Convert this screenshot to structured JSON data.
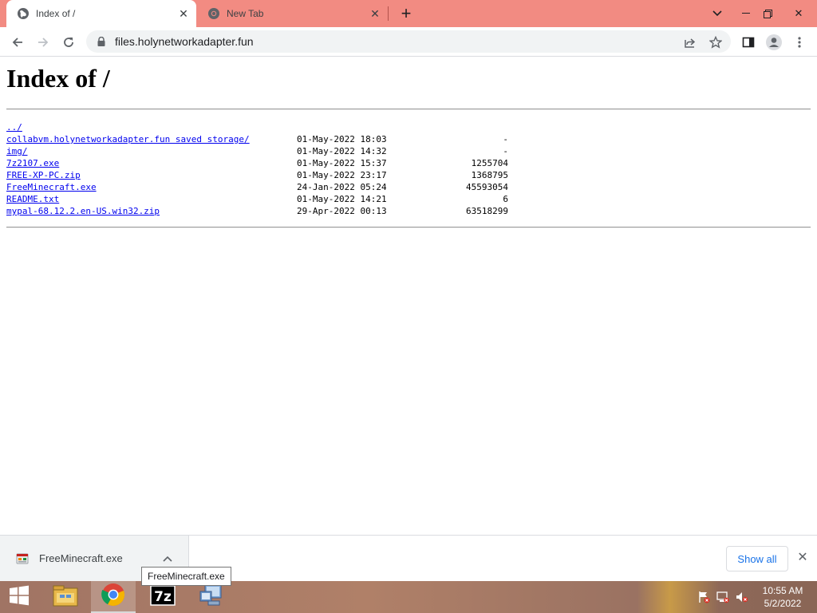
{
  "browser": {
    "tabs": [
      {
        "title": "Index of /",
        "active": true,
        "icon": "globe-icon"
      },
      {
        "title": "New Tab",
        "active": false,
        "icon": "chrome-icon"
      }
    ],
    "url": "files.holynetworkadapter.fun",
    "colors": {
      "tab_strip": "#f28b82",
      "link": "#0000ee",
      "accent": "#1a73e8"
    }
  },
  "page": {
    "title": "Index of /",
    "entries": [
      {
        "name": "../",
        "date": "",
        "size": ""
      },
      {
        "name": "collabvm.holynetworkadapter.fun saved storage/",
        "date": "01-May-2022 18:03",
        "size": "-"
      },
      {
        "name": "img/",
        "date": "01-May-2022 14:32",
        "size": "-"
      },
      {
        "name": "7z2107.exe",
        "date": "01-May-2022 15:37",
        "size": "1255704"
      },
      {
        "name": "FREE-XP-PC.zip",
        "date": "01-May-2022 23:17",
        "size": "1368795"
      },
      {
        "name": "FreeMinecraft.exe",
        "date": "24-Jan-2022 05:24",
        "size": "45593054"
      },
      {
        "name": "README.txt",
        "date": "01-May-2022 14:21",
        "size": "6"
      },
      {
        "name": "mypal-68.12.2.en-US.win32.zip",
        "date": "29-Apr-2022 00:13",
        "size": "63518299"
      }
    ]
  },
  "downloads": {
    "item_name": "FreeMinecraft.exe",
    "tooltip": "FreeMinecraft.exe",
    "show_all": "Show all"
  },
  "taskbar": {
    "apps": [
      "file-explorer-icon",
      "chrome-icon",
      "7zip-icon",
      "network-computer-icon"
    ],
    "time": "10:55 AM",
    "date": "5/2/2022"
  }
}
